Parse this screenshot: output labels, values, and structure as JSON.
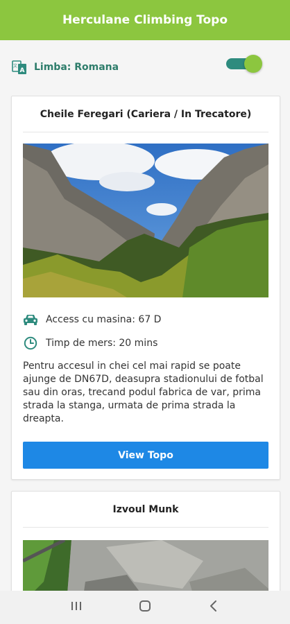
{
  "app": {
    "title": "Herculane Climbing Topo"
  },
  "language": {
    "label": "Limba: Romana",
    "toggle_on": true
  },
  "colors": {
    "primary": "#8cc63f",
    "teal": "#2e8b7e",
    "button": "#1e88e5"
  },
  "cards": [
    {
      "title": "Cheile Feregari (Cariera / In Trecatore)",
      "access": "Access cu masina: 67 D",
      "walk_time": "Timp de mers: 20 mins",
      "description": "Pentru accesul in chei cel mai rapid se poate ajunge de DN67D, deasupra stadionului de fotbal sau din oras, trecand podul fabrica de var, prima strada la stanga, urmata de prima strada la dreapta.",
      "button_label": "View Topo"
    },
    {
      "title": "Izvoul Munk"
    }
  ],
  "navbar": {
    "icons": [
      "recents-icon",
      "home-icon",
      "back-icon"
    ]
  }
}
